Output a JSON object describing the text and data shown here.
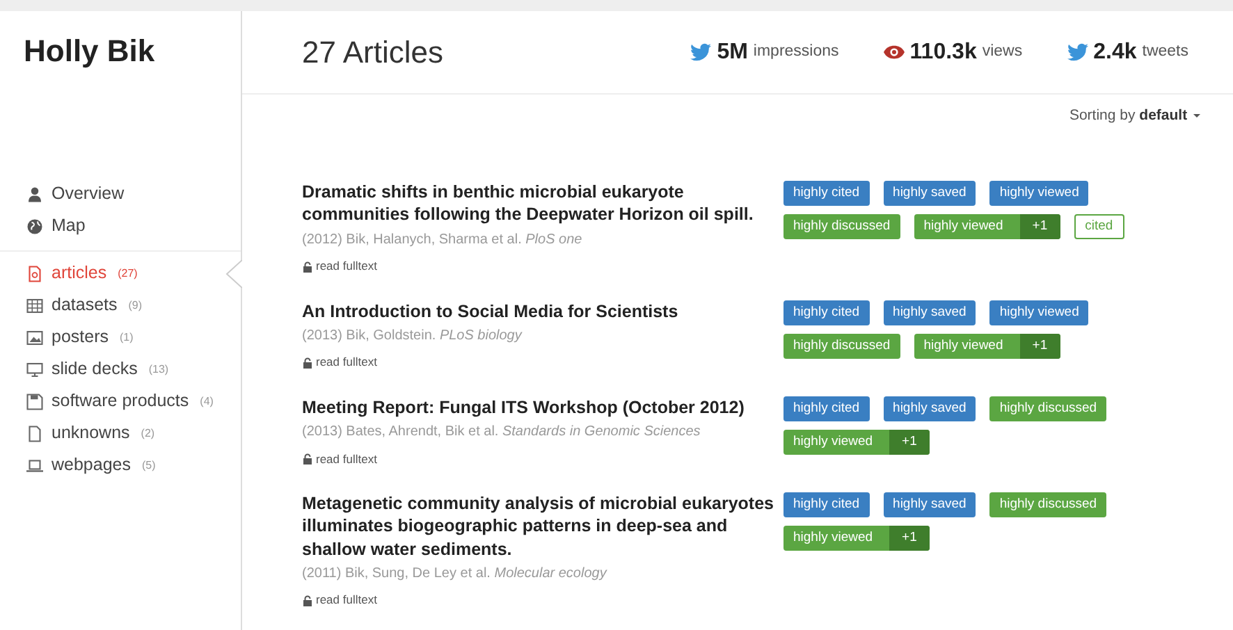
{
  "profile": {
    "name": "Holly Bik"
  },
  "header": {
    "count": "27",
    "count_label": "Articles",
    "stats": [
      {
        "value": "5M",
        "label": "impressions"
      },
      {
        "value": "110.3k",
        "label": "views"
      },
      {
        "value": "2.4k",
        "label": "tweets"
      }
    ]
  },
  "sorting": {
    "label": "Sorting by",
    "value": "default"
  },
  "sidebar": {
    "top_items": [
      {
        "label": "Overview"
      },
      {
        "label": "Map"
      }
    ],
    "items": [
      {
        "label": "articles",
        "count": "(27)",
        "selected": true
      },
      {
        "label": "datasets",
        "count": "(9)",
        "selected": false
      },
      {
        "label": "posters",
        "count": "(1)",
        "selected": false
      },
      {
        "label": "slide decks",
        "count": "(13)",
        "selected": false
      },
      {
        "label": "software products",
        "count": "(4)",
        "selected": false
      },
      {
        "label": "unknowns",
        "count": "(2)",
        "selected": false
      },
      {
        "label": "webpages",
        "count": "(5)",
        "selected": false
      }
    ]
  },
  "articles": [
    {
      "title": "Dramatic shifts in benthic microbial eukaryote communities following the Deepwater Horizon oil spill.",
      "citation": "(2012) Bik, Halanych, Sharma et al. *PloS one*",
      "link": "read fulltext",
      "badges": [
        {
          "kind": "blue",
          "label": "highly cited"
        },
        {
          "kind": "blue",
          "label": "highly saved"
        },
        {
          "kind": "blue",
          "label": "highly viewed"
        },
        {
          "kind": "green",
          "label": "highly discussed"
        },
        {
          "kind": "green",
          "label": "highly viewed",
          "extra": "+1"
        },
        {
          "kind": "outline",
          "label": "cited"
        }
      ]
    },
    {
      "title": "An Introduction to Social Media for Scientists",
      "citation": "(2013) Bik, Goldstein. *PLoS biology*",
      "link": "read fulltext",
      "badges": [
        {
          "kind": "blue",
          "label": "highly cited"
        },
        {
          "kind": "blue",
          "label": "highly saved"
        },
        {
          "kind": "blue",
          "label": "highly viewed"
        },
        {
          "kind": "green",
          "label": "highly discussed"
        },
        {
          "kind": "green",
          "label": "highly viewed",
          "extra": "+1"
        }
      ]
    },
    {
      "title": "Meeting Report: Fungal ITS Workshop (October 2012)",
      "citation": "(2013) Bates, Ahrendt, Bik et al. *Standards in Genomic Sciences*",
      "link": "read fulltext",
      "badges": [
        {
          "kind": "blue",
          "label": "highly cited"
        },
        {
          "kind": "blue",
          "label": "highly saved"
        },
        {
          "kind": "green",
          "label": "highly discussed"
        },
        {
          "kind": "green",
          "label": "highly viewed",
          "extra": "+1"
        }
      ]
    },
    {
      "title": "Metagenetic community analysis of microbial eukaryotes illuminates biogeographic patterns in deep-sea and shallow water sediments.",
      "citation": "(2011) Bik, Sung, De Ley et al. *Molecular ecology*",
      "link": "read fulltext",
      "badges": [
        {
          "kind": "blue",
          "label": "highly cited"
        },
        {
          "kind": "blue",
          "label": "highly saved"
        },
        {
          "kind": "green",
          "label": "highly discussed"
        },
        {
          "kind": "green",
          "label": "highly viewed",
          "extra": "+1"
        }
      ]
    }
  ]
}
